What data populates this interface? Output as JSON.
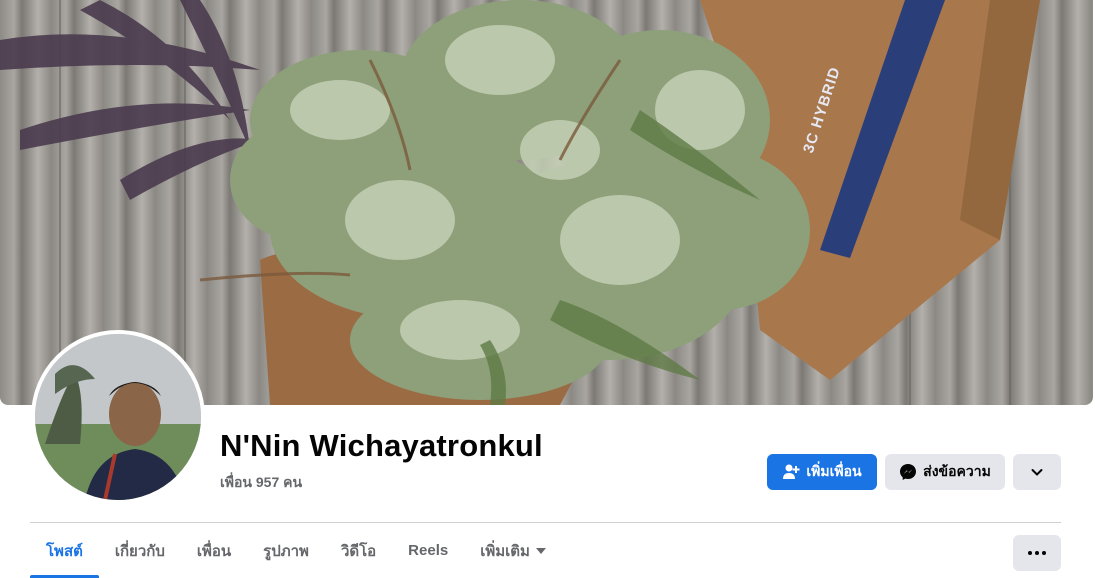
{
  "profile": {
    "name": "N'Nin Wichayatronkul",
    "friends_label": "เพื่อน",
    "friends_count": "957",
    "friends_unit": "คน"
  },
  "cover": {
    "bag_label": "3C HYBRID"
  },
  "actions": {
    "add_friend": "เพิ่มเพื่อน",
    "message": "ส่งข้อความ",
    "more_icon": "chevron-down-icon"
  },
  "tabs": [
    {
      "label": "โพสต์",
      "active": true
    },
    {
      "label": "เกี่ยวกับ",
      "active": false
    },
    {
      "label": "เพื่อน",
      "active": false
    },
    {
      "label": "รูปภาพ",
      "active": false
    },
    {
      "label": "วิดีโอ",
      "active": false
    },
    {
      "label": "Reels",
      "active": false
    },
    {
      "label": "เพิ่มเติม",
      "active": false
    }
  ],
  "colors": {
    "accent": "#1b74e4",
    "secondary_button": "#e4e6eb",
    "text_primary": "#050505",
    "text_secondary": "#65676b"
  }
}
